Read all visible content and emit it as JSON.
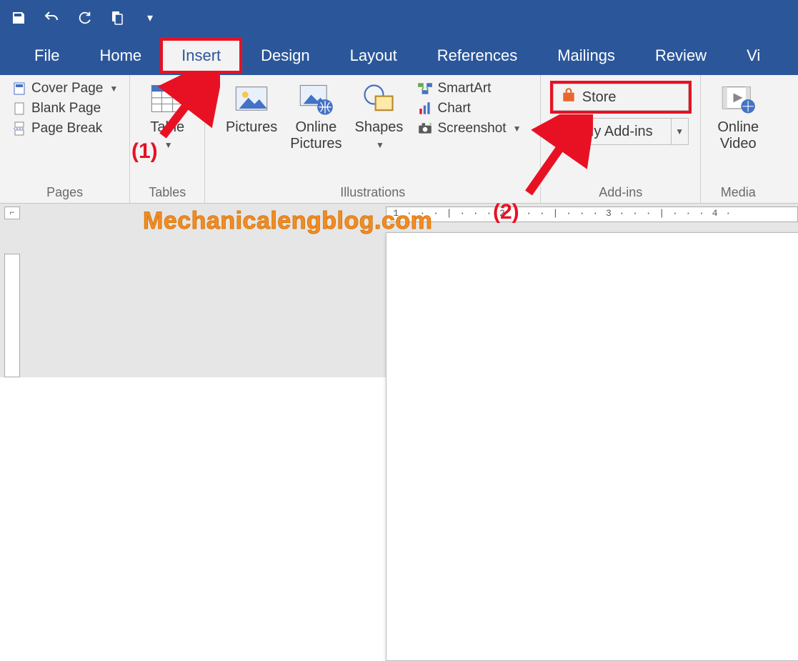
{
  "qat": {
    "items": [
      "save",
      "undo",
      "redo",
      "touch-mode",
      "customize"
    ]
  },
  "tabs": [
    "File",
    "Home",
    "Insert",
    "Design",
    "Layout",
    "References",
    "Mailings",
    "Review",
    "Vi"
  ],
  "activeTab": "Insert",
  "ribbon": {
    "pages": {
      "label": "Pages",
      "items": {
        "coverPage": "Cover Page",
        "blankPage": "Blank Page",
        "pageBreak": "Page Break"
      }
    },
    "tables": {
      "label": "Tables",
      "table": "Table"
    },
    "illustrations": {
      "label": "Illustrations",
      "pictures": "Pictures",
      "onlinePictures": "Online\nPictures",
      "shapes": "Shapes",
      "smartArt": "SmartArt",
      "chart": "Chart",
      "screenshot": "Screenshot"
    },
    "addins": {
      "label": "Add-ins",
      "store": "Store",
      "myAddins": "My Add-ins"
    },
    "media": {
      "label": "Media",
      "onlineVideo": "Online\nVideo"
    }
  },
  "annotations": {
    "one": "(1)",
    "two": "(2)",
    "watermark": "Mechanicalengblog.com"
  },
  "ruler": {
    "ticks": " 1 · · · | · · · 2 · · · | · · · 3 · · · | · · · 4 · "
  }
}
